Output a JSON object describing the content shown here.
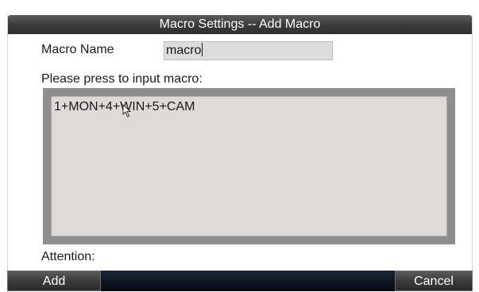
{
  "dialog": {
    "title": "Macro Settings -- Add Macro"
  },
  "form": {
    "macro_name_label": "Macro Name",
    "macro_name_value": "macro",
    "input_prompt": "Please press to input macro:",
    "macro_sequence": "1+MON+4+WIN+5+CAM",
    "attention_label": "Attention:"
  },
  "buttons": {
    "add_label": "Add",
    "cancel_label": "Cancel"
  },
  "colors": {
    "title_bar": "#3a3a3a",
    "input_background": "#dcdcdc",
    "macro_area_background": "#dedad8",
    "macro_frame": "#8e8e8e",
    "bottom_bar": "#0c1420"
  }
}
